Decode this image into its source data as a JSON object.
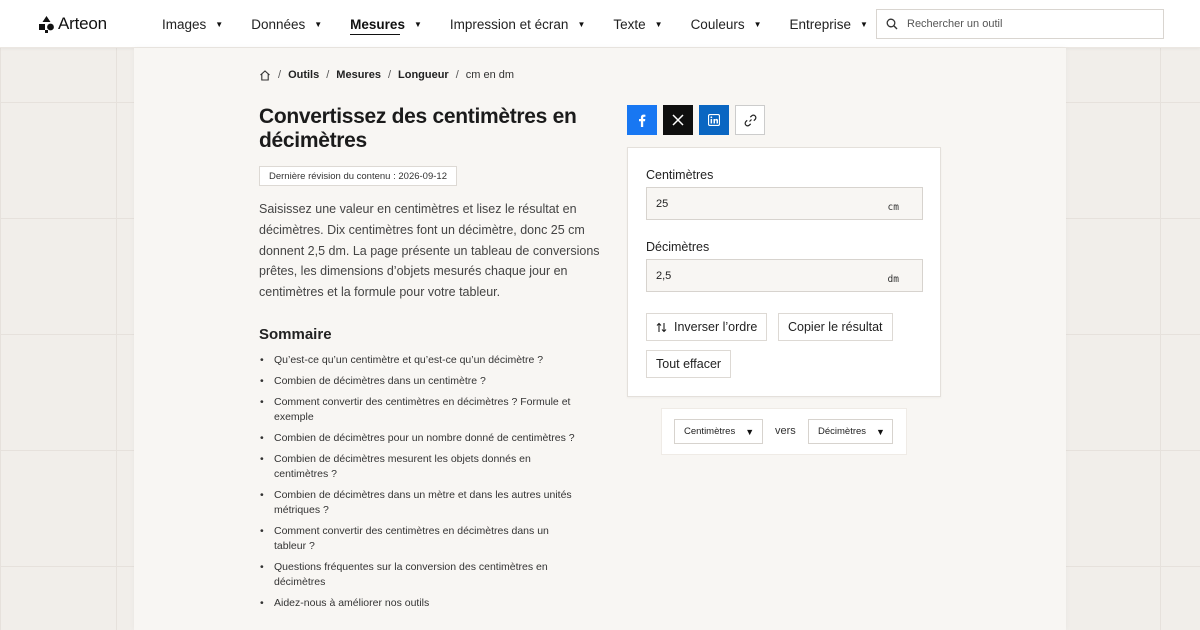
{
  "brand": {
    "name": "Arteon"
  },
  "nav": {
    "items": [
      {
        "label": "Images",
        "caret": "▼"
      },
      {
        "label": "Données",
        "caret": "▼"
      },
      {
        "label": "Mesures",
        "caret": "▼",
        "active": true
      },
      {
        "label": "Impression et écran",
        "caret": "▼"
      },
      {
        "label": "Texte",
        "caret": "▼"
      },
      {
        "label": "Couleurs",
        "caret": "▼"
      },
      {
        "label": "Entreprise",
        "caret": "▼"
      }
    ]
  },
  "search": {
    "placeholder": "Rechercher un outil",
    "icon": "search-icon"
  },
  "breadcrumb": {
    "home_icon": "home-icon",
    "separator": "/",
    "items": [
      "Outils",
      "Mesures",
      "Longueur"
    ],
    "current": "cm en dm"
  },
  "page": {
    "title": "Convertissez des centimètres en décimètres",
    "revision": "Dernière révision du contenu : 2026-09-12",
    "intro": "Saisissez une valeur en centimètres et lisez le résultat en décimètres. Dix centimètres font un décimètre, donc 25 cm donnent 2,5 dm. La page présente un tableau de conversions prêtes, les dimensions d’objets mesurés chaque jour en centimètres et la formule pour votre tableur."
  },
  "toc": {
    "title": "Sommaire",
    "items": [
      "Qu’est-ce qu’un centimètre et qu’est-ce qu’un décimètre ?",
      "Combien de décimètres dans un centimètre ?",
      "Comment convertir des centimètres en décimètres ? Formule et exemple",
      "Combien de décimètres pour un nombre donné de centimètres ?",
      "Combien de décimètres mesurent les objets donnés en centimètres ?",
      "Combien de décimètres dans un mètre et dans les autres unités métriques ?",
      "Comment convertir des centimètres en décimètres dans un tableur ?",
      "Questions fréquentes sur la conversion des centimètres en décimètres",
      "Aidez-nous à améliorer nos outils"
    ]
  },
  "share": {
    "buttons": [
      "facebook-icon",
      "x-icon",
      "linkedin-icon",
      "link-icon"
    ],
    "colors": {
      "facebook": "#1877f2",
      "x": "#0f0f0f",
      "linkedin": "#0a66c2"
    }
  },
  "converter": {
    "from": {
      "label": "Centimètres",
      "value": "25",
      "unit": "cm"
    },
    "to": {
      "label": "Décimètres",
      "value": "2,5",
      "unit": "dm"
    },
    "swap_label": "Inverser l’ordre",
    "copy_label": "Copier le résultat",
    "clear_label": "Tout effacer"
  },
  "unit_selector": {
    "from": "Centimètres",
    "connector": "vers",
    "to": "Décimètres",
    "caret": "▼"
  }
}
